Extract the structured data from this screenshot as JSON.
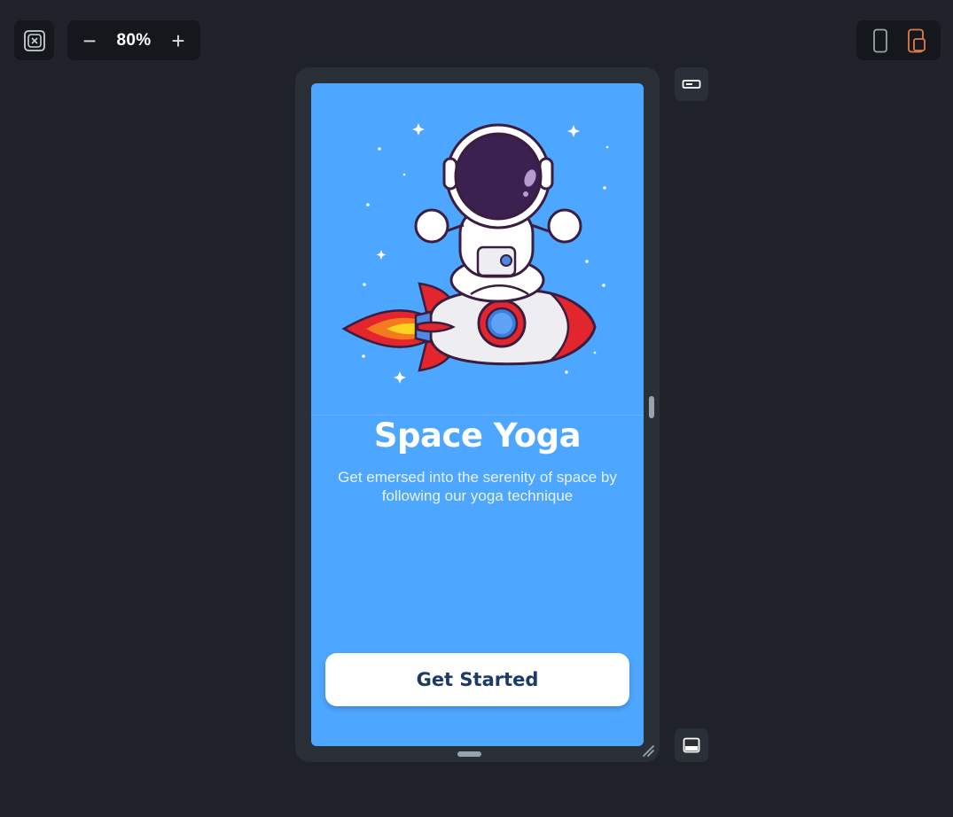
{
  "toolbar": {
    "fit_icon": "command-icon",
    "zoom_out_label": "−",
    "zoom_level": "80%",
    "zoom_in_label": "+",
    "device_phone_icon": "phone-icon",
    "device_tablet_icon": "tablet-icon",
    "active_device": "tablet"
  },
  "side_controls": {
    "top_icon": "landscape-icon",
    "bottom_icon": "keyboard-toggle-icon"
  },
  "screen": {
    "background_color": "#4da6ff",
    "title": "Space Yoga",
    "subtitle": "Get emersed into the serenity of space by following our yoga technique",
    "cta_label": "Get Started",
    "cta_text_color": "#1b3a66"
  },
  "colors": {
    "app_background": "#1f2329",
    "frame": "#2a3038",
    "accent": "#e07a4a"
  }
}
